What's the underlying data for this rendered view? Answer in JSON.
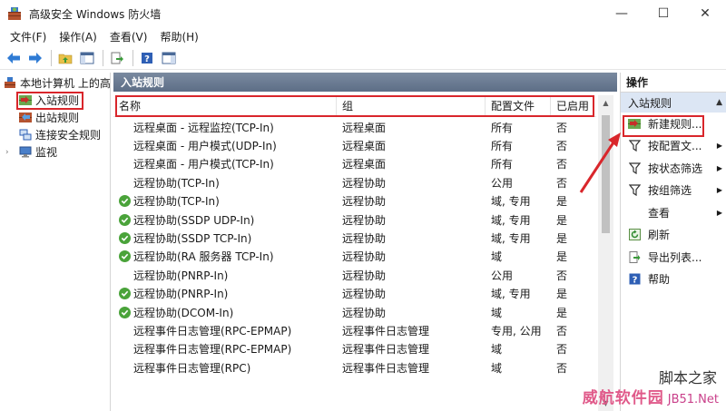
{
  "window": {
    "title": "高级安全 Windows 防火墙",
    "minimize": "—",
    "maximize": "☐",
    "close": "✕"
  },
  "menu": [
    "文件(F)",
    "操作(A)",
    "查看(V)",
    "帮助(H)"
  ],
  "tree": {
    "root": "本地计算机 上的高",
    "items": [
      {
        "label": "入站规则",
        "icon": "inbound-rules-icon",
        "selected": true
      },
      {
        "label": "出站规则",
        "icon": "outbound-rules-icon"
      },
      {
        "label": "连接安全规则",
        "icon": "connection-security-icon"
      },
      {
        "label": "监视",
        "icon": "monitor-icon"
      }
    ]
  },
  "center": {
    "title": "入站规则",
    "columns": [
      "名称",
      "组",
      "配置文件",
      "已启用"
    ],
    "rows": [
      {
        "enabled_icon": false,
        "name": "远程桌面 - 远程监控(TCP-In)",
        "group": "远程桌面",
        "profile": "所有",
        "enabled": "否"
      },
      {
        "enabled_icon": false,
        "name": "远程桌面 - 用户模式(UDP-In)",
        "group": "远程桌面",
        "profile": "所有",
        "enabled": "否"
      },
      {
        "enabled_icon": false,
        "name": "远程桌面 - 用户模式(TCP-In)",
        "group": "远程桌面",
        "profile": "所有",
        "enabled": "否"
      },
      {
        "enabled_icon": false,
        "name": "远程协助(TCP-In)",
        "group": "远程协助",
        "profile": "公用",
        "enabled": "否"
      },
      {
        "enabled_icon": true,
        "name": "远程协助(TCP-In)",
        "group": "远程协助",
        "profile": "域, 专用",
        "enabled": "是"
      },
      {
        "enabled_icon": true,
        "name": "远程协助(SSDP UDP-In)",
        "group": "远程协助",
        "profile": "域, 专用",
        "enabled": "是"
      },
      {
        "enabled_icon": true,
        "name": "远程协助(SSDP TCP-In)",
        "group": "远程协助",
        "profile": "域, 专用",
        "enabled": "是"
      },
      {
        "enabled_icon": true,
        "name": "远程协助(RA 服务器 TCP-In)",
        "group": "远程协助",
        "profile": "域",
        "enabled": "是"
      },
      {
        "enabled_icon": false,
        "name": "远程协助(PNRP-In)",
        "group": "远程协助",
        "profile": "公用",
        "enabled": "否"
      },
      {
        "enabled_icon": true,
        "name": "远程协助(PNRP-In)",
        "group": "远程协助",
        "profile": "域, 专用",
        "enabled": "是"
      },
      {
        "enabled_icon": true,
        "name": "远程协助(DCOM-In)",
        "group": "远程协助",
        "profile": "域",
        "enabled": "是"
      },
      {
        "enabled_icon": false,
        "name": "远程事件日志管理(RPC-EPMAP)",
        "group": "远程事件日志管理",
        "profile": "专用, 公用",
        "enabled": "否"
      },
      {
        "enabled_icon": false,
        "name": "远程事件日志管理(RPC-EPMAP)",
        "group": "远程事件日志管理",
        "profile": "域",
        "enabled": "否"
      },
      {
        "enabled_icon": false,
        "name": "远程事件日志管理(RPC)",
        "group": "远程事件日志管理",
        "profile": "域",
        "enabled": "否"
      }
    ]
  },
  "actions": {
    "title": "操作",
    "section": "入站规则",
    "items": [
      {
        "label": "新建规则...",
        "icon": "new-rule-icon",
        "arrow": false
      },
      {
        "label": "按配置文...",
        "icon": "filter-icon",
        "arrow": true
      },
      {
        "label": "按状态筛选",
        "icon": "filter-icon",
        "arrow": true
      },
      {
        "label": "按组筛选",
        "icon": "filter-icon",
        "arrow": true
      },
      {
        "label": "查看",
        "icon": "",
        "arrow": true
      },
      {
        "label": "刷新",
        "icon": "refresh-icon",
        "arrow": false
      },
      {
        "label": "导出列表...",
        "icon": "export-icon",
        "arrow": false
      },
      {
        "label": "帮助",
        "icon": "help-icon",
        "arrow": false
      }
    ]
  },
  "watermark": {
    "line1": "脚本之家",
    "line2": "JB51.Net",
    "line3": "威航软件园"
  },
  "colors": {
    "highlight_red": "#d9262b",
    "enabled_green": "#4aa33a",
    "header_blue": "#5d6e86",
    "action_section_bg": "#dce6f4"
  }
}
